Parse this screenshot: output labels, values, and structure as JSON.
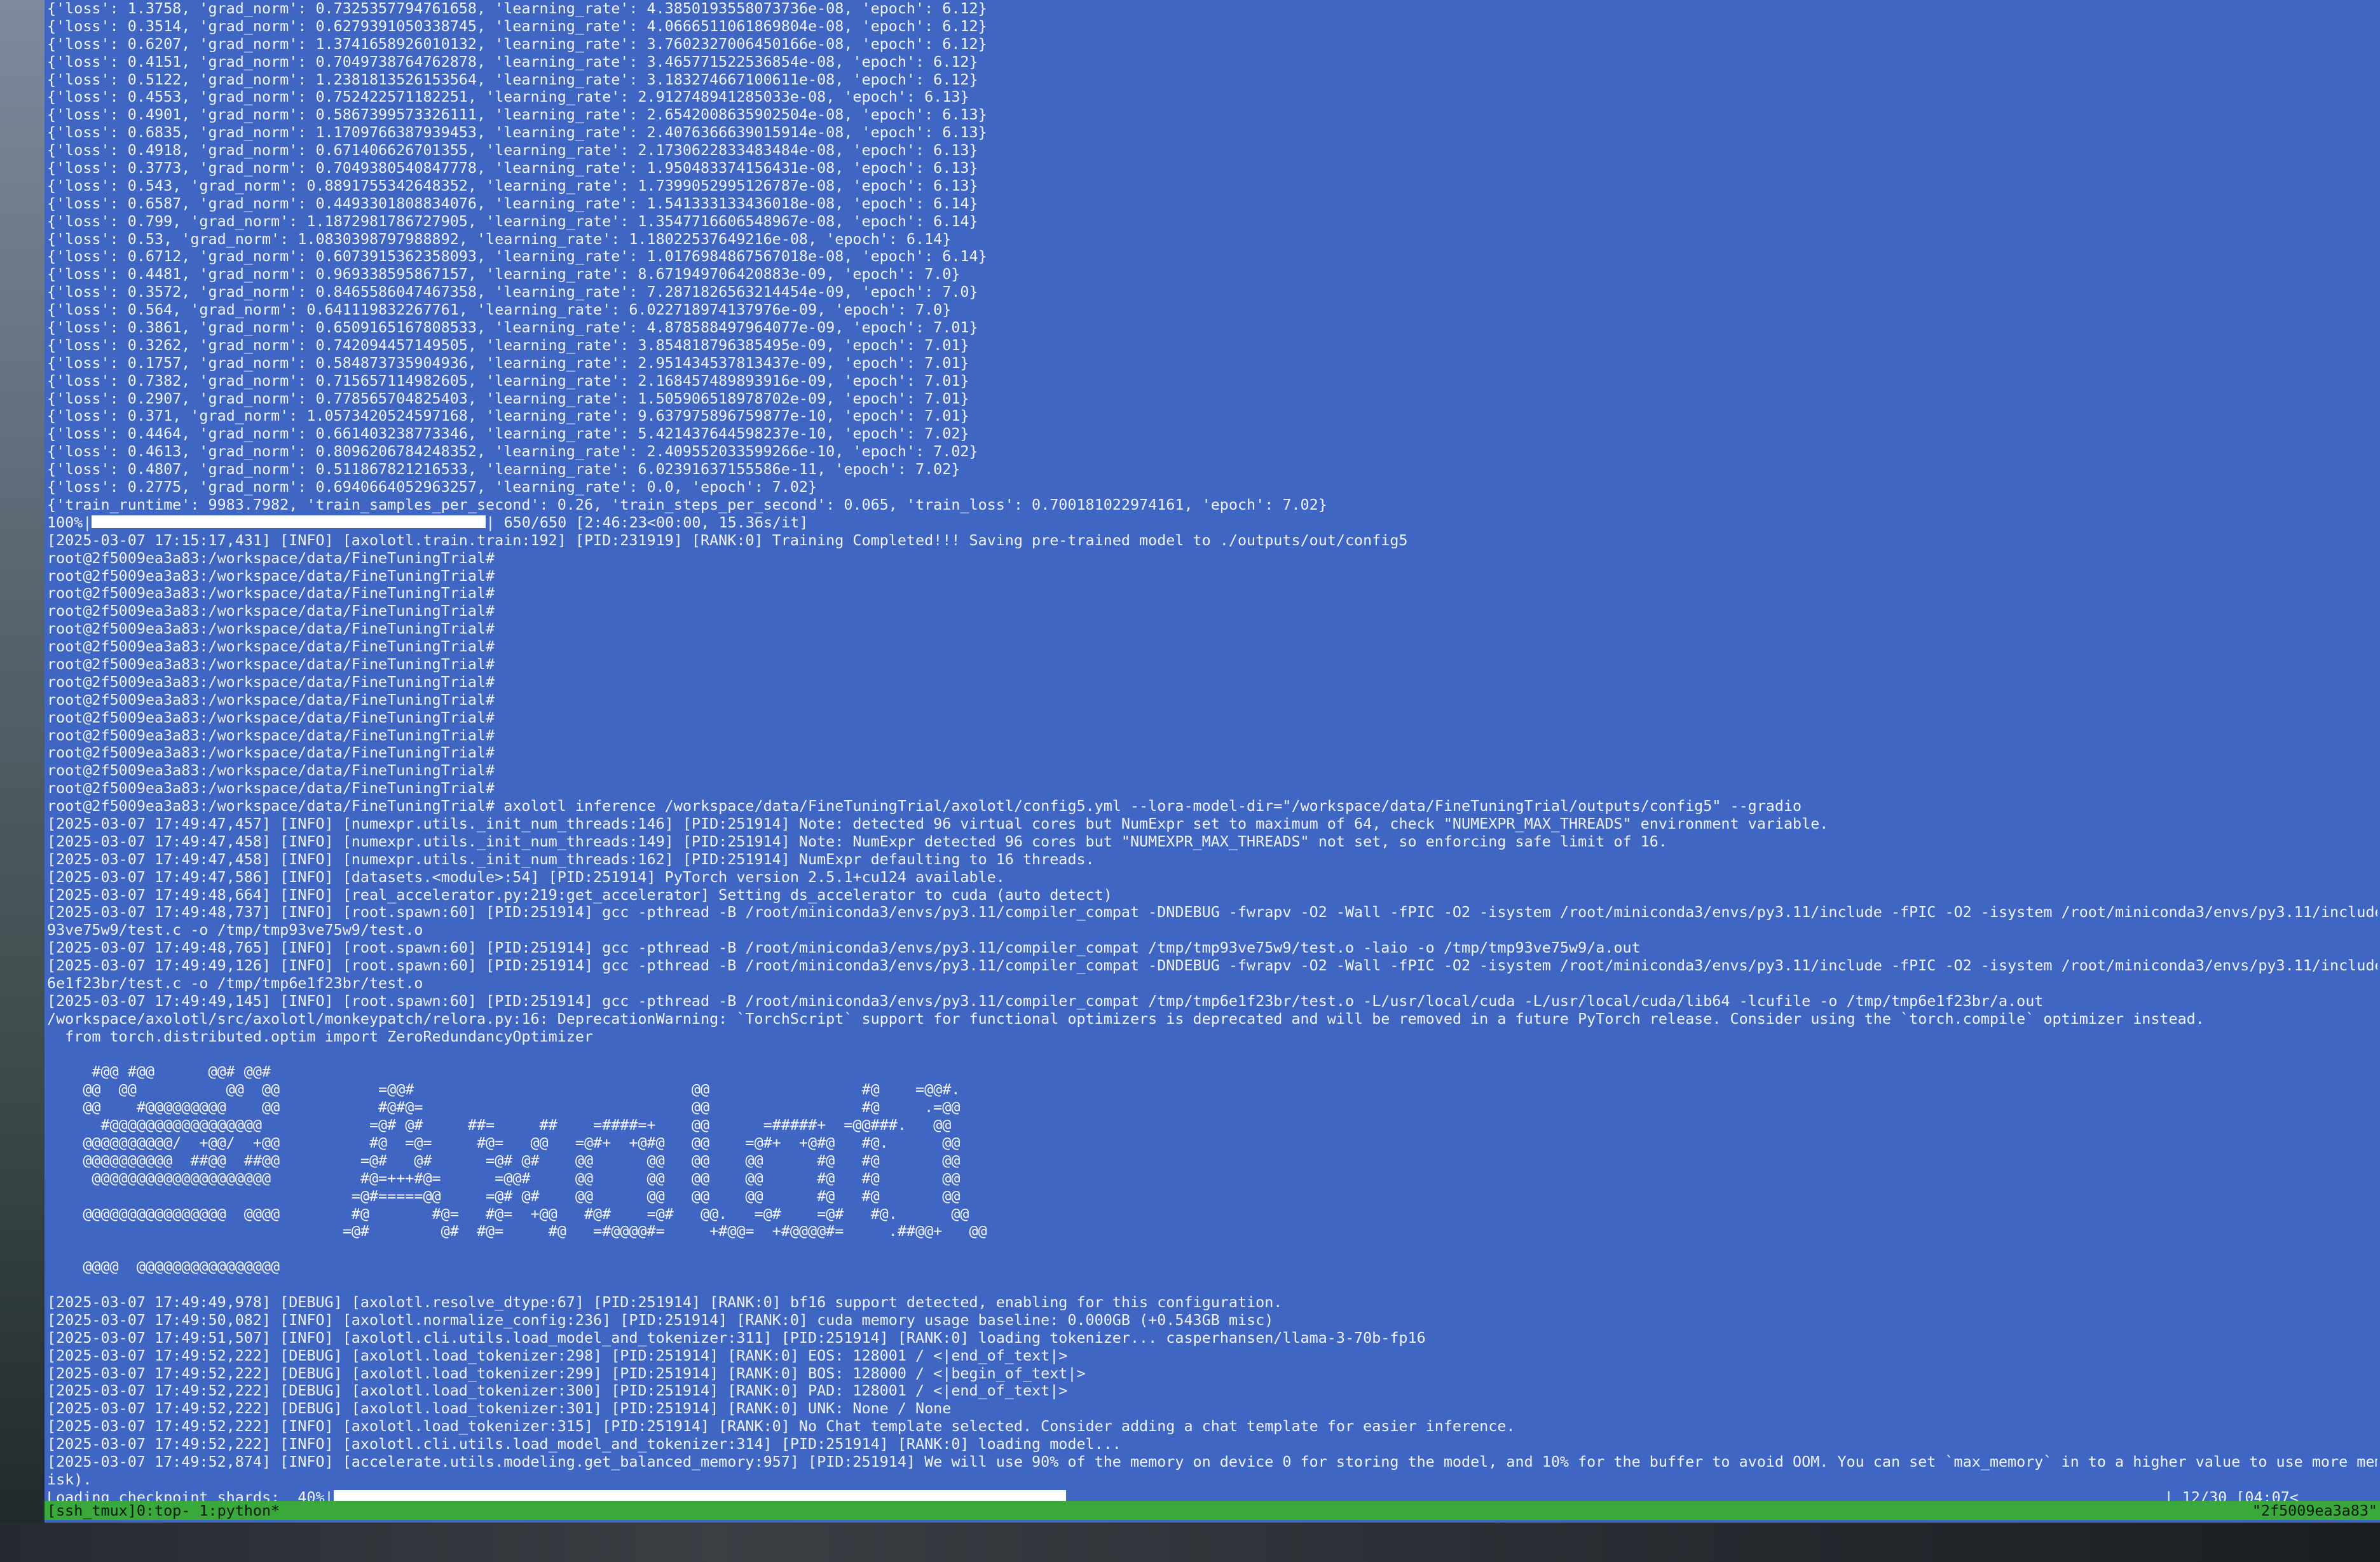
{
  "terminal": {
    "lines": [
      "{'loss': 1.3758, 'grad_norm': 0.7325357794761658, 'learning_rate': 4.3850193558073736e-08, 'epoch': 6.12}",
      "{'loss': 0.3514, 'grad_norm': 0.6279391050338745, 'learning_rate': 4.0666511061869804e-08, 'epoch': 6.12}",
      "{'loss': 0.6207, 'grad_norm': 1.3741658926010132, 'learning_rate': 3.7602327006450166e-08, 'epoch': 6.12}",
      "{'loss': 0.4151, 'grad_norm': 0.7049738764762878, 'learning_rate': 3.465771522536854e-08, 'epoch': 6.12}",
      "{'loss': 0.5122, 'grad_norm': 1.2381813526153564, 'learning_rate': 3.183274667100611e-08, 'epoch': 6.12}",
      "{'loss': 0.4553, 'grad_norm': 0.752422571182251, 'learning_rate': 2.912748941285033e-08, 'epoch': 6.13}",
      "{'loss': 0.4901, 'grad_norm': 0.5867399573326111, 'learning_rate': 2.6542008635902504e-08, 'epoch': 6.13}",
      "{'loss': 0.6835, 'grad_norm': 1.1709766387939453, 'learning_rate': 2.4076366639015914e-08, 'epoch': 6.13}",
      "{'loss': 0.4918, 'grad_norm': 0.671406626701355, 'learning_rate': 2.1730622833483484e-08, 'epoch': 6.13}",
      "{'loss': 0.3773, 'grad_norm': 0.7049380540847778, 'learning_rate': 1.950483374156431e-08, 'epoch': 6.13}",
      "{'loss': 0.543, 'grad_norm': 0.8891755342648352, 'learning_rate': 1.7399052995126787e-08, 'epoch': 6.13}",
      "{'loss': 0.6587, 'grad_norm': 0.4493301808834076, 'learning_rate': 1.541333133436018e-08, 'epoch': 6.14}",
      "{'loss': 0.799, 'grad_norm': 1.1872981786727905, 'learning_rate': 1.3547716606548967e-08, 'epoch': 6.14}",
      "{'loss': 0.53, 'grad_norm': 1.0830398797988892, 'learning_rate': 1.18022537649216e-08, 'epoch': 6.14}",
      "{'loss': 0.6712, 'grad_norm': 0.6073915362358093, 'learning_rate': 1.0176984867567018e-08, 'epoch': 6.14}",
      "{'loss': 0.4481, 'grad_norm': 0.969338595867157, 'learning_rate': 8.671949706420883e-09, 'epoch': 7.0}",
      "{'loss': 0.3572, 'grad_norm': 0.8465586047467358, 'learning_rate': 7.2871826563214454e-09, 'epoch': 7.0}",
      "{'loss': 0.564, 'grad_norm': 0.641119832267761, 'learning_rate': 6.022718974137976e-09, 'epoch': 7.0}",
      "{'loss': 0.3861, 'grad_norm': 0.6509165167808533, 'learning_rate': 4.878588497964077e-09, 'epoch': 7.01}",
      "{'loss': 0.3262, 'grad_norm': 0.742094457149505, 'learning_rate': 3.854818796385495e-09, 'epoch': 7.01}",
      "{'loss': 0.1757, 'grad_norm': 0.584873735904936, 'learning_rate': 2.951434537813437e-09, 'epoch': 7.01}",
      "{'loss': 0.7382, 'grad_norm': 0.715657114982605, 'learning_rate': 2.168457489893916e-09, 'epoch': 7.01}",
      "{'loss': 0.2907, 'grad_norm': 0.778565704825403, 'learning_rate': 1.505906518978702e-09, 'epoch': 7.01}",
      "{'loss': 0.371, 'grad_norm': 1.0573420524597168, 'learning_rate': 9.637975896759877e-10, 'epoch': 7.01}",
      "{'loss': 0.4464, 'grad_norm': 0.661403238773346, 'learning_rate': 5.421437644598237e-10, 'epoch': 7.02}",
      "{'loss': 0.4613, 'grad_norm': 0.8096206784248352, 'learning_rate': 2.409552033599266e-10, 'epoch': 7.02}",
      "{'loss': 0.4807, 'grad_norm': 0.511867821216533, 'learning_rate': 6.02391637155586e-11, 'epoch': 7.02}",
      "{'loss': 0.2775, 'grad_norm': 0.6940664052963257, 'learning_rate': 0.0, 'epoch': 7.02}",
      "{'train_runtime': 9983.7982, 'train_samples_per_second': 0.26, 'train_steps_per_second': 0.065, 'train_loss': 0.700181022974161, 'epoch': 7.02}"
    ],
    "progress_line": {
      "prefix": "100%|",
      "fraction": 1.0,
      "suffix": "| 650/650 [2:46:23<00:00, 15.36s/it]"
    },
    "lines_after_progress": [
      "[2025-03-07 17:15:17,431] [INFO] [axolotl.train.train:192] [PID:231919] [RANK:0] Training Completed!!! Saving pre-trained model to ./outputs/out/config5",
      "root@2f5009ea3a83:/workspace/data/FineTuningTrial#",
      "root@2f5009ea3a83:/workspace/data/FineTuningTrial#",
      "root@2f5009ea3a83:/workspace/data/FineTuningTrial#",
      "root@2f5009ea3a83:/workspace/data/FineTuningTrial#",
      "root@2f5009ea3a83:/workspace/data/FineTuningTrial#",
      "root@2f5009ea3a83:/workspace/data/FineTuningTrial#",
      "root@2f5009ea3a83:/workspace/data/FineTuningTrial#",
      "root@2f5009ea3a83:/workspace/data/FineTuningTrial#",
      "root@2f5009ea3a83:/workspace/data/FineTuningTrial#",
      "root@2f5009ea3a83:/workspace/data/FineTuningTrial#",
      "root@2f5009ea3a83:/workspace/data/FineTuningTrial#",
      "root@2f5009ea3a83:/workspace/data/FineTuningTrial#",
      "root@2f5009ea3a83:/workspace/data/FineTuningTrial#",
      "root@2f5009ea3a83:/workspace/data/FineTuningTrial#",
      "root@2f5009ea3a83:/workspace/data/FineTuningTrial# axolotl inference /workspace/data/FineTuningTrial/axolotl/config5.yml --lora-model-dir=\"/workspace/data/FineTuningTrial/outputs/config5\" --gradio",
      "[2025-03-07 17:49:47,457] [INFO] [numexpr.utils._init_num_threads:146] [PID:251914] Note: detected 96 virtual cores but NumExpr set to maximum of 64, check \"NUMEXPR_MAX_THREADS\" environment variable.",
      "[2025-03-07 17:49:47,458] [INFO] [numexpr.utils._init_num_threads:149] [PID:251914] Note: NumExpr detected 96 cores but \"NUMEXPR_MAX_THREADS\" not set, so enforcing safe limit of 16.",
      "[2025-03-07 17:49:47,458] [INFO] [numexpr.utils._init_num_threads:162] [PID:251914] NumExpr defaulting to 16 threads.",
      "[2025-03-07 17:49:47,586] [INFO] [datasets.<module>:54] [PID:251914] PyTorch version 2.5.1+cu124 available.",
      "[2025-03-07 17:49:48,664] [INFO] [real_accelerator.py:219:get_accelerator] Setting ds_accelerator to cuda (auto detect)",
      "[2025-03-07 17:49:48,737] [INFO] [root.spawn:60] [PID:251914] gcc -pthread -B /root/miniconda3/envs/py3.11/compiler_compat -DNDEBUG -fwrapv -O2 -Wall -fPIC -O2 -isystem /root/miniconda3/envs/py3.11/include -fPIC -O2 -isystem /root/miniconda3/envs/py3.11/include -c /tmp/tmp",
      "93ve75w9/test.c -o /tmp/tmp93ve75w9/test.o",
      "[2025-03-07 17:49:48,765] [INFO] [root.spawn:60] [PID:251914] gcc -pthread -B /root/miniconda3/envs/py3.11/compiler_compat /tmp/tmp93ve75w9/test.o -laio -o /tmp/tmp93ve75w9/a.out",
      "[2025-03-07 17:49:49,126] [INFO] [root.spawn:60] [PID:251914] gcc -pthread -B /root/miniconda3/envs/py3.11/compiler_compat -DNDEBUG -fwrapv -O2 -Wall -fPIC -O2 -isystem /root/miniconda3/envs/py3.11/include -fPIC -O2 -isystem /root/miniconda3/envs/py3.11/include -c /tmp/tmp",
      "6e1f23br/test.c -o /tmp/tmp6e1f23br/test.o",
      "[2025-03-07 17:49:49,145] [INFO] [root.spawn:60] [PID:251914] gcc -pthread -B /root/miniconda3/envs/py3.11/compiler_compat /tmp/tmp6e1f23br/test.o -L/usr/local/cuda -L/usr/local/cuda/lib64 -lcufile -o /tmp/tmp6e1f23br/a.out",
      "/workspace/axolotl/src/axolotl/monkeypatch/relora.py:16: DeprecationWarning: `TorchScript` support for functional optimizers is deprecated and will be removed in a future PyTorch release. Consider using the `torch.compile` optimizer instead.",
      "  from torch.distributed.optim import ZeroRedundancyOptimizer",
      ""
    ],
    "banner": [
      "     #@@ #@@      @@# @@#",
      "    @@  @@          @@  @@           =@@#                               @@                 #@    =@@#.",
      "    @@    #@@@@@@@@@    @@           #@#@=                              @@                 #@     .=@@",
      "      #@@@@@@@@@@@@@@@@@            =@# @#     ##=     ##    =####=+    @@      =#####+  =@@###.   @@",
      "    @@@@@@@@@@/  +@@/  +@@          #@  =@=     #@=   @@   =@#+  +@#@   @@    =@#+  +@#@   #@.      @@",
      "    @@@@@@@@@@  ##@@  ##@@         =@#   @#      =@# @#    @@      @@   @@    @@      #@   #@       @@",
      "     @@@@@@@@@@@@@@@@@@@@          #@=+++#@=      =@@#     @@      @@   @@    @@      #@   #@       @@",
      "                                  =@#=====@@     =@# @#    @@      @@   @@    @@      #@   #@       @@",
      "    @@@@@@@@@@@@@@@@  @@@@        #@       #@=   #@=  +@@   #@#    =@#   @@.   =@#    =@#   #@.      @@",
      "                                 =@#        @#  #@=     #@   =#@@@@#=     +#@@=  +#@@@@#=     .##@@+   @@",
      "",
      "    @@@@  @@@@@@@@@@@@@@@@",
      ""
    ],
    "lines_after_banner": [
      "[2025-03-07 17:49:49,978] [DEBUG] [axolotl.resolve_dtype:67] [PID:251914] [RANK:0] bf16 support detected, enabling for this configuration.",
      "[2025-03-07 17:49:50,082] [INFO] [axolotl.normalize_config:236] [PID:251914] [RANK:0] cuda memory usage baseline: 0.000GB (+0.543GB misc)",
      "[2025-03-07 17:49:51,507] [INFO] [axolotl.cli.utils.load_model_and_tokenizer:311] [PID:251914] [RANK:0] loading tokenizer... casperhansen/llama-3-70b-fp16",
      "[2025-03-07 17:49:52,222] [DEBUG] [axolotl.load_tokenizer:298] [PID:251914] [RANK:0] EOS: 128001 / <|end_of_text|>",
      "[2025-03-07 17:49:52,222] [DEBUG] [axolotl.load_tokenizer:299] [PID:251914] [RANK:0] BOS: 128000 / <|begin_of_text|>",
      "[2025-03-07 17:49:52,222] [DEBUG] [axolotl.load_tokenizer:300] [PID:251914] [RANK:0] PAD: 128001 / <|end_of_text|>",
      "[2025-03-07 17:49:52,222] [DEBUG] [axolotl.load_tokenizer:301] [PID:251914] [RANK:0] UNK: None / None",
      "[2025-03-07 17:49:52,222] [INFO] [axolotl.load_tokenizer:315] [PID:251914] [RANK:0] No Chat template selected. Consider adding a chat template for easier inference.",
      "[2025-03-07 17:49:52,222] [INFO] [axolotl.cli.utils.load_model_and_tokenizer:314] [PID:251914] [RANK:0] loading model...",
      "[2025-03-07 17:49:52,874] [INFO] [accelerate.utils.modeling.get_balanced_memory:957] [PID:251914] We will use 90% of the memory on device 0 for storing the model, and 10% for the buffer to avoid OOM. You can set `max_memory` in to a higher value to use more memory (at your own r",
      "isk)."
    ],
    "loading_line": {
      "prefix": "Loading checkpoint shards:  40%|",
      "fraction": 0.4,
      "suffix": "| 12/30 [04:07<"
    }
  },
  "status_bar": {
    "left": "[ssh_tmux]0:top- 1:python*",
    "right": "\"2f5009ea3a83\""
  },
  "colors": {
    "terminal_bg": "#4066c4",
    "text": "#eef2fb",
    "status_bar_bg": "#3aa83a"
  }
}
